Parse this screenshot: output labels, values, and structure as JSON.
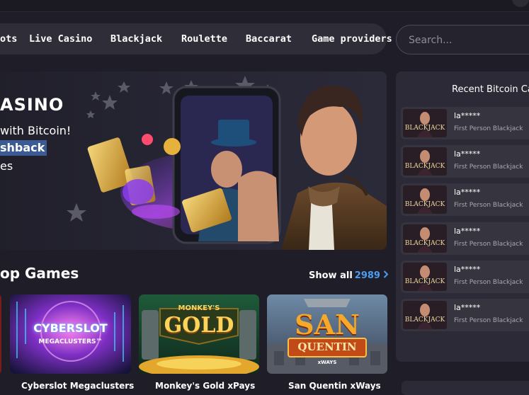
{
  "nav": {
    "items": [
      "ots",
      "Live Casino",
      "Blackjack",
      "Roulette",
      "Baccarat",
      "Game providers"
    ]
  },
  "search": {
    "placeholder": "Search..."
  },
  "hero": {
    "title": "ASINO",
    "line1": "with Bitcoin!",
    "line2": "shback",
    "line3": "es"
  },
  "top_games": {
    "title": "op Games",
    "show_all_label": "Show all",
    "show_all_count": "2989",
    "cards": [
      {
        "logo_line1": "CYBERSLOT",
        "logo_line2": "MEGACLUSTERS™",
        "title": "Cyberslot Megaclusters"
      },
      {
        "logo_line1": "MONKEY'S",
        "logo_line2": "GOLD",
        "title": "Monkey's Gold xPays"
      },
      {
        "logo_line1": "SAN",
        "logo_line2": "QUENTIN",
        "logo_line3": "xWAYS",
        "title": "San Quentin xWays"
      }
    ]
  },
  "recent": {
    "title": "Recent Bitcoin Ca",
    "thumb_label": "BLACKJACK",
    "items": [
      {
        "user": "la*****",
        "game": "First Person Blackjack"
      },
      {
        "user": "la*****",
        "game": "First Person Blackjack"
      },
      {
        "user": "la*****",
        "game": "First Person Blackjack"
      },
      {
        "user": "la*****",
        "game": "First Person Blackjack"
      },
      {
        "user": "la*****",
        "game": "First Person Blackjack"
      },
      {
        "user": "la*****",
        "game": "First Person Blackjack"
      }
    ]
  },
  "colors": {
    "background": "#1f1e28",
    "nav_bg": "#2e2d38",
    "accent_blue": "#4a9df0",
    "highlight": "#3c5b94",
    "panel_bg": "#2b2a36"
  }
}
